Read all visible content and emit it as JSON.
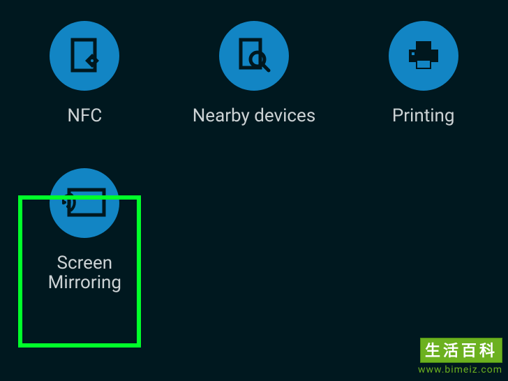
{
  "tiles": [
    {
      "label": "NFC"
    },
    {
      "label": "Nearby devices"
    },
    {
      "label": "Printing"
    },
    {
      "label": "Screen\nMirroring"
    }
  ],
  "watermark": {
    "title": "生活百科",
    "url": "www.bimeiz.com"
  }
}
